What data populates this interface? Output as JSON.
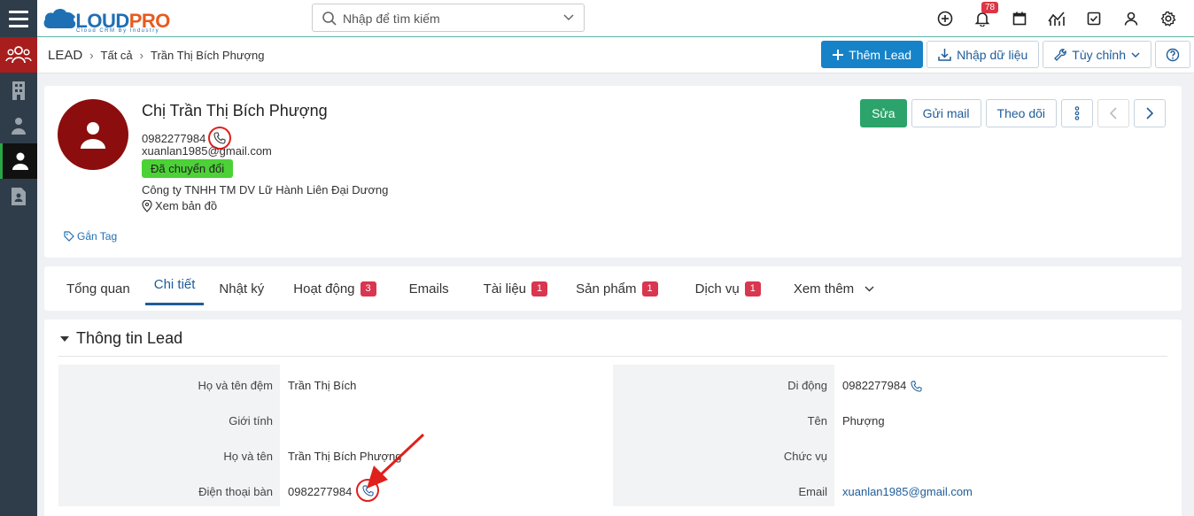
{
  "logo": {
    "text_a": "CLOUD",
    "text_b": "PRO",
    "subtitle": "Cloud CRM By Industry"
  },
  "search": {
    "placeholder": "Nhập để tìm kiếm"
  },
  "notifications": {
    "count": "78"
  },
  "breadcrumb": {
    "module": "LEAD",
    "level1": "Tất cả",
    "level2": "Trần Thị Bích Phượng"
  },
  "toolbar": {
    "add_lead": "Thêm Lead",
    "import": "Nhập dữ liệu",
    "customize": "Tùy chỉnh"
  },
  "profile": {
    "name": "Chị Trần Thị Bích Phượng",
    "phone": "0982277984",
    "email": "xuanlan1985@gmail.com",
    "status": "Đã chuyển đổi",
    "company": "Công ty TNHH TM DV Lữ Hành Liên Đại Dương",
    "map_link": "Xem bản đồ",
    "tag_link": "Gắn Tag",
    "edit": "Sửa",
    "send_mail": "Gửi mail",
    "follow": "Theo dõi"
  },
  "tabs": [
    {
      "label": "Tổng quan",
      "badge": ""
    },
    {
      "label": "Chi tiết",
      "badge": ""
    },
    {
      "label": "Nhật ký",
      "badge": ""
    },
    {
      "label": "Hoạt động",
      "badge": "3"
    },
    {
      "label": "Emails",
      "badge": ""
    },
    {
      "label": "Tài liệu",
      "badge": "1"
    },
    {
      "label": "Sản phẩm",
      "badge": "1"
    },
    {
      "label": "Dịch vụ",
      "badge": "1"
    },
    {
      "label": "Xem thêm",
      "badge": ""
    }
  ],
  "info": {
    "title": "Thông tin Lead",
    "left": [
      {
        "label": "Họ và tên đệm",
        "value": "Trần Thị Bích"
      },
      {
        "label": "Giới tính",
        "value": ""
      },
      {
        "label": "Họ và tên",
        "value": "Trần Thị Bích Phượng"
      },
      {
        "label": "Điện thoại bàn",
        "value": "0982277984"
      }
    ],
    "right": [
      {
        "label": "Di động",
        "value": "0982277984"
      },
      {
        "label": "Tên",
        "value": "Phượng"
      },
      {
        "label": "Chức vụ",
        "value": ""
      },
      {
        "label": "Email",
        "value": "xuanlan1985@gmail.com"
      }
    ]
  },
  "colors": {
    "primary": "#1682c8",
    "success": "#2ba36a",
    "avatar": "#8c0d0d",
    "status": "#4cd137",
    "badge": "#d9364f",
    "highlight": "#e0201b"
  }
}
